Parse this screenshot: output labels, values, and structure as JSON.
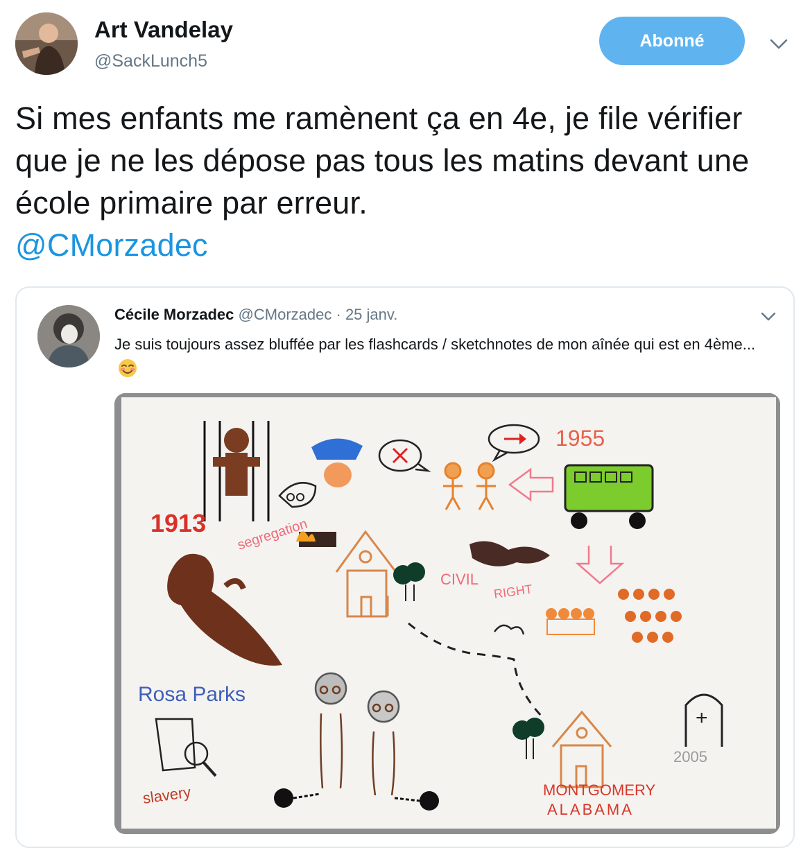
{
  "tweet": {
    "author_name": "Art Vandelay",
    "author_handle": "@SackLunch5",
    "follow_label": "Abonné",
    "text": "Si mes enfants me ramènent ça en 4e, je file vérifier que je ne les dépose pas tous les matins devant une école primaire par erreur.",
    "mention": "@CMorzadec"
  },
  "quoted": {
    "author_name": "Cécile Morzadec",
    "author_handle": "@CMorzadec",
    "separator": "·",
    "date": "25 janv.",
    "text": "Je suis toujours assez bluffée par les flashcards / sketchnotes de mon aînée qui est en 4ème...",
    "emoji": "smiling-face-with-smiling-eyes"
  },
  "drawing": {
    "labels": {
      "year_1913": "1913",
      "year_1955": "1955",
      "year_2005": "2005",
      "segregation": "segregation",
      "civil_rights_1": "CIVIL",
      "civil_rights_2": "RIGHT",
      "rosa_parks": "Rosa Parks",
      "slavery": "slavery",
      "montgomery": "MONTGOMERY",
      "alabama": "ALABAMA",
      "grave_cross": "+"
    }
  },
  "icons": {
    "caret": "chevron-down-icon",
    "emoji": "smiling-face-icon"
  },
  "colors": {
    "follow_button": "#5fb4f0",
    "link": "#1b95e0",
    "handle": "#657786",
    "card_border": "#e1e8ed"
  }
}
